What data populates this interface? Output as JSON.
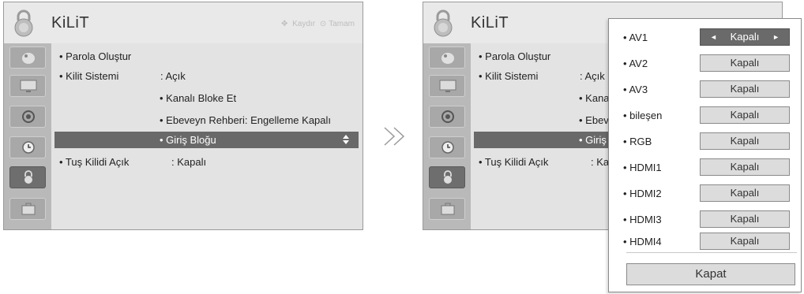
{
  "menu": {
    "title": "KiLiT",
    "hint_scroll": "Kaydır",
    "hint_ok": "Tamam",
    "items": {
      "set_password": "• Parola Oluştur",
      "lock_system": "• Kilit Sistemi",
      "lock_system_value": ": Açık",
      "block_channel": "• Kanalı Bloke Et",
      "parental_guidance": "• Ebeveyn Rehberi: Engelleme Kapalı",
      "input_block": "• Giriş Bloğu",
      "key_lock": "• Tuş Kilidi Açık",
      "key_lock_value": ": Kapalı"
    },
    "right_truncated": {
      "lock_system_value": ": Açık",
      "block_channel": "• Kanal",
      "parental_guidance": "• Ebevey",
      "input_block": "• Giriş B",
      "key_lock_value": ": Kap"
    }
  },
  "transition_arrow": "≫",
  "popup": {
    "rows": [
      {
        "label": "• AV1",
        "value": "Kapalı",
        "selected": true
      },
      {
        "label": "• AV2",
        "value": "Kapalı"
      },
      {
        "label": "• AV3",
        "value": "Kapalı"
      },
      {
        "label": "• bileşen",
        "value": "Kapalı"
      },
      {
        "label": "• RGB",
        "value": "Kapalı"
      },
      {
        "label": "• HDMI1",
        "value": "Kapalı"
      },
      {
        "label": "• HDMI2",
        "value": "Kapalı"
      },
      {
        "label": "• HDMI3",
        "value": "Kapalı"
      },
      {
        "label": "• HDMI4",
        "value": "Kapalı"
      }
    ],
    "left_arrow": "◄",
    "right_arrow": "►",
    "close_label": "Kapat"
  },
  "colors": {
    "panel_bg": "#e3e3e3",
    "sidebar_bg": "#b9b9b9",
    "highlight": "#696969",
    "selected_value_bg": "#6a6a6a",
    "button_bg": "#dcdcdc"
  }
}
